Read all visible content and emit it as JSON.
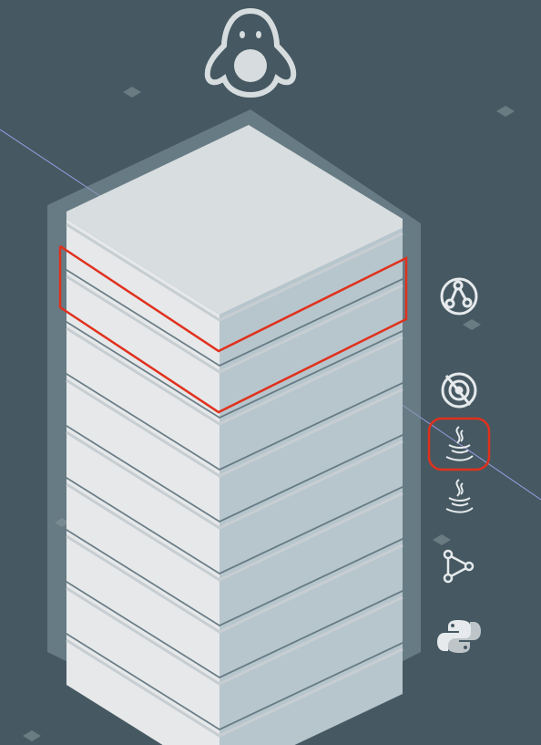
{
  "scene": {
    "background": "#465962",
    "os_logo_icon": "linux-penguin-icon",
    "server_color_top": "#d8dde0",
    "server_color_left": "#e6e8ea",
    "server_color_right": "#b7c6cd",
    "highlight_color": "#e0311d",
    "accent_line_color": "#9c9ce6"
  },
  "server_stack": {
    "layer_count": 9,
    "highlighted_layer_index": 1
  },
  "sidebar": {
    "icons": [
      {
        "name": "kafka-nodes-icon",
        "selected": false
      },
      {
        "name": "signal-target-icon",
        "selected": false
      },
      {
        "name": "java-icon",
        "selected": true
      },
      {
        "name": "java-icon",
        "selected": false
      },
      {
        "name": "graph-nodes-icon",
        "selected": false
      },
      {
        "name": "python-icon",
        "selected": false
      }
    ]
  }
}
